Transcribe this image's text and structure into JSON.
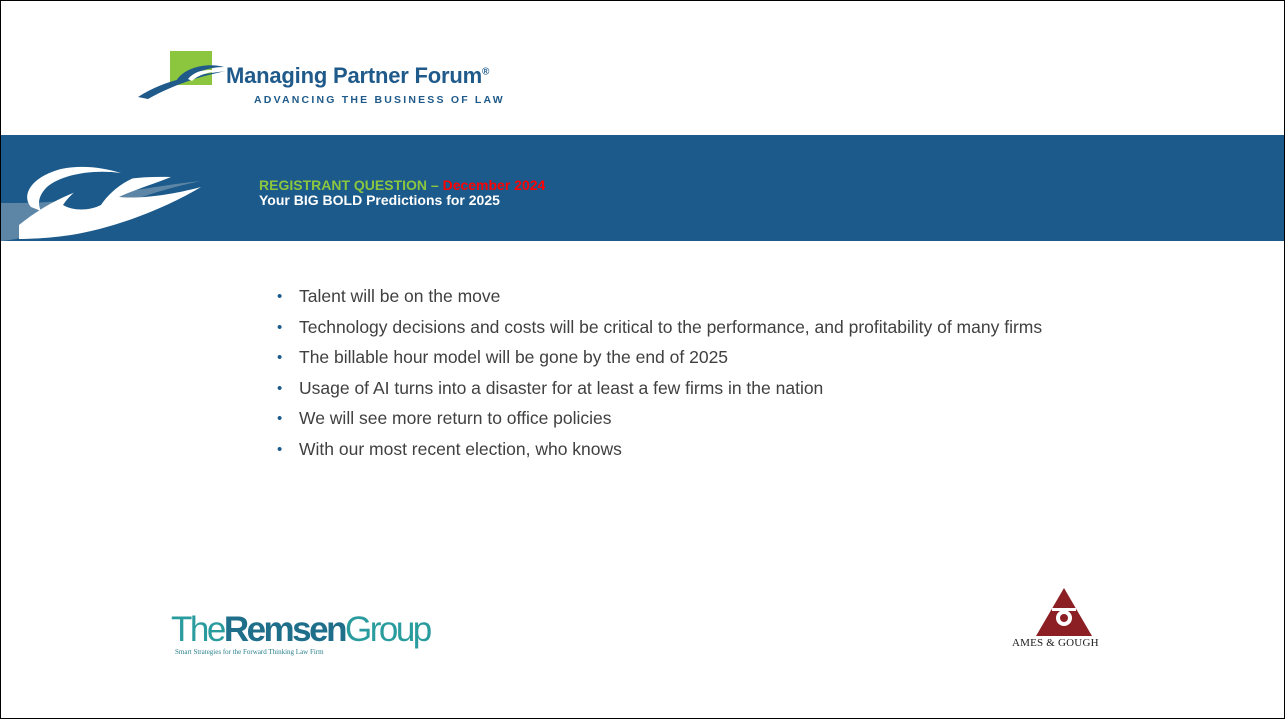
{
  "header_logo": {
    "name": "Managing Partner Forum",
    "registered_mark": "®",
    "tagline": "ADVANCING THE BUSINESS OF LAW"
  },
  "band": {
    "title_prefix": "REGISTRANT QUESTION – ",
    "title_date": "December 2024",
    "subtitle": "Your BIG BOLD Predictions for 2025"
  },
  "bullets": [
    {
      "marker": "•",
      "text": "Talent will be on the move"
    },
    {
      "marker": "•",
      "text": "Technology decisions and costs will be critical to the performance, and profitability of many firms"
    },
    {
      "marker": "•",
      "text": "The billable hour model will be gone by the end of 2025"
    },
    {
      "marker": "•",
      "text": "Usage of AI turns into a disaster for at least a few firms in the nation"
    },
    {
      "marker": "•",
      "text": "We will see more return to office policies"
    },
    {
      "marker": "•",
      "text": "With our most recent election, who knows"
    }
  ],
  "footer_logos": {
    "remsen_prefix": "The",
    "remsen_bold": "Remsen",
    "remsen_suffix": "Group",
    "remsen_tagline": "Smart Strategies for the Forward Thinking Law Firm",
    "ames_name": "AMES & GOUGH"
  },
  "colors": {
    "band_blue": "#1b5a8a",
    "title_green": "#8cc63f",
    "date_red": "#ff0000",
    "logo_blue": "#1f5a8a",
    "logo_green": "#8cc63f",
    "ames_red": "#8b1f24"
  }
}
